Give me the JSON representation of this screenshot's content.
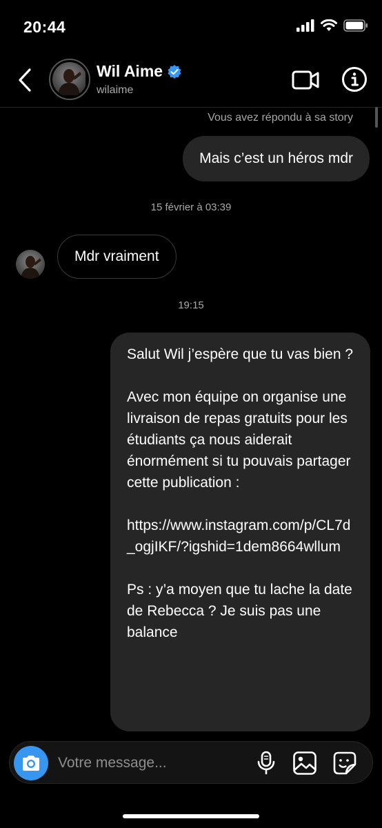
{
  "status_bar": {
    "time": "20:44"
  },
  "header": {
    "contact_name": "Wil Aime",
    "username": "wilaime",
    "icons": {
      "back": "chevron-left-icon",
      "verified": "verified-badge-icon",
      "video": "video-camera-icon",
      "info": "info-icon"
    }
  },
  "chat": {
    "story_reply_note": "Vous avez répondu à sa story",
    "sent_message_1": "Mais c’est un héros mdr",
    "timestamp_1": "15 février à 03:39",
    "received_message_1": "Mdr vraiment",
    "timestamp_2": "19:15",
    "sent_message_2": {
      "paragraph_1": "Salut Wil j’espère que tu vas bien ?",
      "paragraph_2": "Avec mon équipe on organise une livraison de repas gratuits pour les étudiants ça nous aiderait énormément si tu pouvais partager cette publication :",
      "paragraph_3": "https://www.instagram.com/p/CL7d_ogjIKF/?igshid=1dem8664wllum",
      "paragraph_4": "Ps : y’a moyen que tu lache la date de Rebecca ? Je suis pas une balance"
    }
  },
  "composer": {
    "placeholder": "Votre message...",
    "icons": {
      "camera": "camera-icon",
      "mic": "microphone-icon",
      "gallery": "image-gallery-icon",
      "sticker": "sticker-icon"
    },
    "accent_color": "#3797f0"
  }
}
